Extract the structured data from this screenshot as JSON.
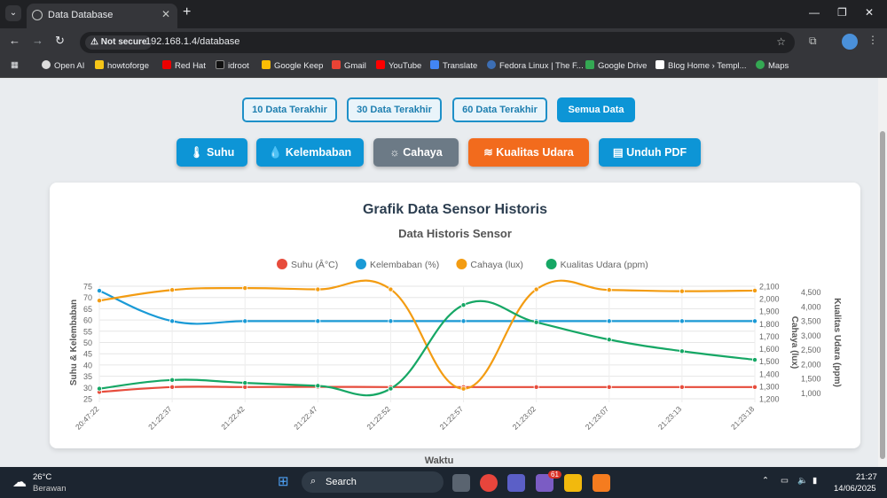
{
  "browser": {
    "tab_title": "Data Database",
    "not_secure": "Not secure",
    "url": "192.168.1.4/database",
    "bookmarks": [
      "Open AI",
      "howtoforge",
      "Red Hat",
      "idroot",
      "Google Keep",
      "Gmail",
      "YouTube",
      "Translate",
      "Fedora Linux | The F...",
      "Google Drive",
      "Blog Home › Templ...",
      "Maps"
    ]
  },
  "filters": [
    "10 Data Terakhir",
    "30 Data Terakhir",
    "60 Data Terakhir",
    "Semua Data"
  ],
  "actions": [
    {
      "label": "Suhu",
      "color": "#0d95d6",
      "icon": "thermometer-icon"
    },
    {
      "label": "Kelembaban",
      "color": "#0d95d6",
      "icon": "droplet-icon"
    },
    {
      "label": "Cahaya",
      "color": "#6c7a86",
      "icon": "sun-icon"
    },
    {
      "label": "Kualitas Udara",
      "color": "#f26b1d",
      "icon": "wind-icon"
    },
    {
      "label": "Unduh PDF",
      "color": "#0d95d6",
      "icon": "pdf-file-icon"
    }
  ],
  "card_title": "Grafik Data Sensor Historis",
  "below_chart": "Waktu",
  "chart_data": {
    "type": "line",
    "title": "Data Historis Sensor",
    "xlabel": "Waktu",
    "ylabel_left": "Suhu & Kelembaban",
    "ylabel_right1": "Cahaya (lux)",
    "ylabel_right2": "Kualitas Udara (ppm)",
    "legend_position": "top",
    "categories": [
      "20:47:22",
      "21:22:37",
      "21:22:42",
      "21:22:47",
      "21:22:52",
      "21:22:57",
      "21:23:02",
      "21:23:07",
      "21:23:13",
      "21:23:18"
    ],
    "yticks_left": [
      "75",
      "70",
      "65",
      "60",
      "55",
      "50",
      "45",
      "40",
      "35",
      "30",
      "25"
    ],
    "yticks_right1": [
      "2,100",
      "2,000",
      "1,900",
      "1,800",
      "1,700",
      "1,600",
      "1,500",
      "1,400",
      "1,300",
      "1,200"
    ],
    "yticks_right2": [
      "4,500",
      "4,000",
      "3,500",
      "3,000",
      "2,500",
      "2,000",
      "1,500",
      "1,000"
    ],
    "ylim_left": [
      25,
      75
    ],
    "ylim_right1": [
      1200,
      2100
    ],
    "ylim_right2": [
      800,
      4700
    ],
    "series": [
      {
        "name": "Suhu (Â°C)",
        "color": "#e74c3c",
        "axis": "left",
        "values": [
          28,
          30.2,
          30.2,
          30.3,
          30.2,
          30.2,
          30.2,
          30.2,
          30.2,
          30.2
        ]
      },
      {
        "name": "Kelembaban (%)",
        "color": "#1a9ad6",
        "axis": "left",
        "values": [
          73,
          59.5,
          59.5,
          59.5,
          59.5,
          59.5,
          59.5,
          59.5,
          59.5,
          59.5
        ]
      },
      {
        "name": "Cahaya (lux)",
        "color": "#f39c12",
        "axis": "right1",
        "values": [
          1985,
          2070,
          2085,
          2075,
          2075,
          1280,
          2075,
          2070,
          2060,
          2065
        ]
      },
      {
        "name": "Kualitas Udara (ppm)",
        "color": "#16a765",
        "axis": "right2",
        "values": [
          1150,
          1450,
          1350,
          1250,
          1150,
          4050,
          3450,
          2850,
          2450,
          2150
        ]
      }
    ]
  },
  "taskbar": {
    "weather_temp": "26°C",
    "weather_text": "Berawan",
    "search": "Search",
    "time": "21:27",
    "date": "14/06/2025",
    "notif": "61"
  }
}
